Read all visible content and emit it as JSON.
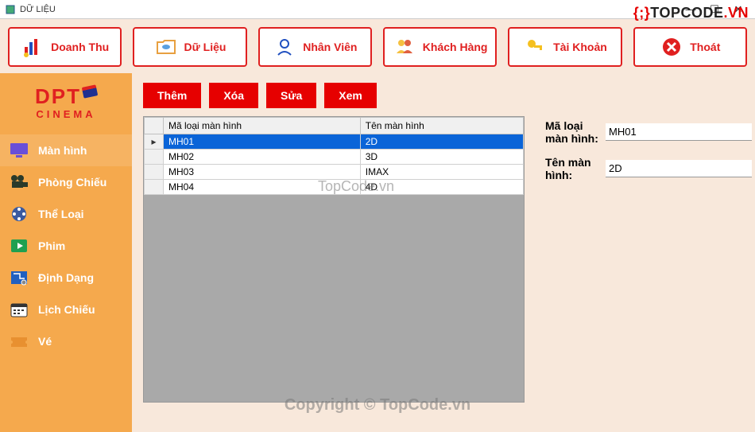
{
  "window": {
    "title": "DỮ LIỆU"
  },
  "topnav": [
    {
      "label": "Doanh Thu"
    },
    {
      "label": "Dữ Liệu"
    },
    {
      "label": "Nhân Viên"
    },
    {
      "label": "Khách Hàng"
    },
    {
      "label": "Tài Khoản"
    },
    {
      "label": "Thoát"
    }
  ],
  "logo": {
    "line1": "DPT",
    "line2": "CINEMA"
  },
  "sidebar": [
    {
      "label": "Màn hình"
    },
    {
      "label": "Phòng Chiếu"
    },
    {
      "label": "Thể Loại"
    },
    {
      "label": "Phim"
    },
    {
      "label": "Định Dạng"
    },
    {
      "label": "Lịch Chiếu"
    },
    {
      "label": "Vé"
    }
  ],
  "actions": {
    "add": "Thêm",
    "del": "Xóa",
    "edit": "Sửa",
    "view": "Xem"
  },
  "table": {
    "headers": {
      "col1": "Mã loại màn hình",
      "col2": "Tên màn hình"
    },
    "rows": [
      {
        "c1": "MH01",
        "c2": "2D"
      },
      {
        "c1": "MH02",
        "c2": "3D"
      },
      {
        "c1": "MH03",
        "c2": "IMAX"
      },
      {
        "c1": "MH04",
        "c2": "4D"
      }
    ]
  },
  "form": {
    "label1": "Mã loại màn hình:",
    "value1": "MH01",
    "label2": "Tên màn hình:",
    "value2": "2D"
  },
  "watermarks": {
    "brand_prefix": "{;}",
    "brand": "TOPCODE",
    "brand_suffix": ".VN",
    "wm2": "TopCode.vn",
    "wm3": "Copyright © TopCode.vn"
  }
}
